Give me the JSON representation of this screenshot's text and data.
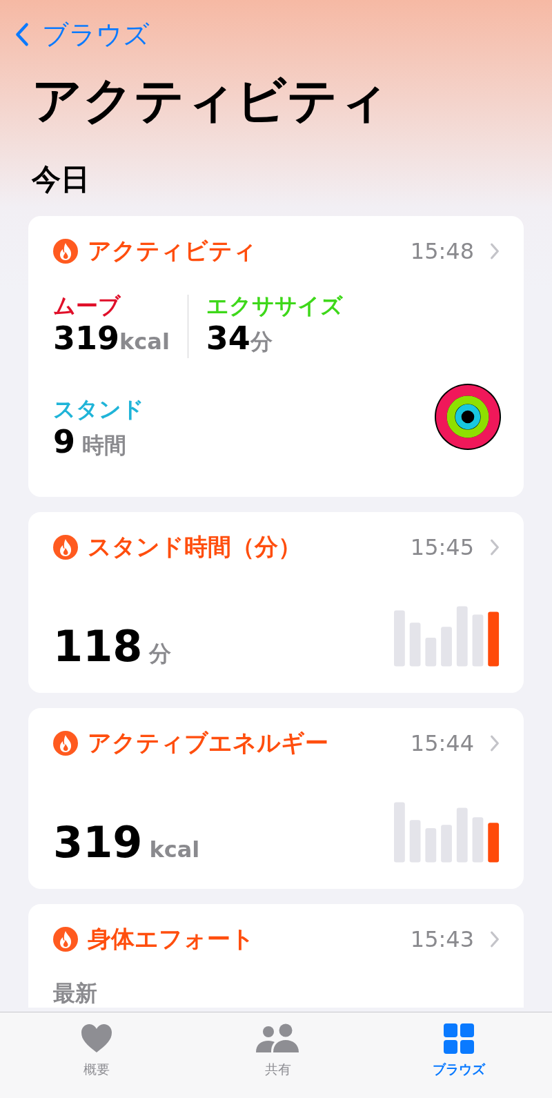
{
  "back": {
    "label": "ブラウズ"
  },
  "title": "アクティビティ",
  "section": "今日",
  "cards": [
    {
      "kind": "summary",
      "title": "アクティビティ",
      "time": "15:48",
      "metrics": [
        {
          "label": "ムーブ",
          "value": "319",
          "unit": "kcal",
          "color": "#e0102a"
        },
        {
          "label": "エクササイズ",
          "value": "34",
          "unit": "分",
          "color": "#3ed81a"
        },
        {
          "label": "スタンド",
          "value": "9",
          "unit": "時間",
          "color": "#1fb4d8"
        }
      ]
    },
    {
      "kind": "bars",
      "title": "スタンド時間（分）",
      "time": "15:45",
      "value": "118",
      "unit": "分"
    },
    {
      "kind": "bars",
      "title": "アクティブエネルギー",
      "time": "15:44",
      "value": "319",
      "unit": "kcal"
    },
    {
      "kind": "latest",
      "title": "身体エフォート",
      "time": "15:43",
      "caption": "最新"
    }
  ],
  "tabs": [
    {
      "label": "概要",
      "selected": false
    },
    {
      "label": "共有",
      "selected": false
    },
    {
      "label": "ブラウズ",
      "selected": true
    }
  ]
}
